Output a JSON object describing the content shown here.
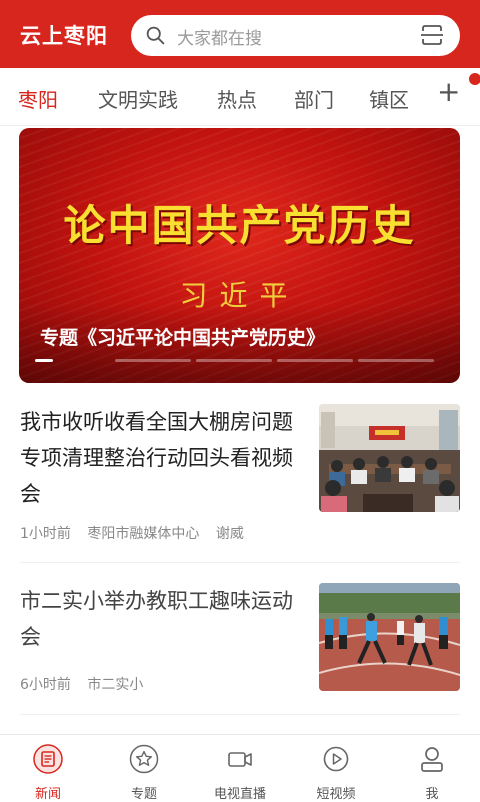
{
  "header": {
    "app_title": "云上枣阳",
    "search_placeholder": "大家都在搜",
    "icons": {
      "search": "search-icon",
      "scan": "scan-icon"
    }
  },
  "tabs": {
    "items": [
      {
        "label": "枣阳",
        "active": true
      },
      {
        "label": "文明实践",
        "active": false
      },
      {
        "label": "热点",
        "active": false
      },
      {
        "label": "部门",
        "active": false
      },
      {
        "label": "镇区",
        "active": false
      }
    ],
    "add_label": "+"
  },
  "banner": {
    "headline": "论中国共产党历史",
    "author": "习近平",
    "caption": "专题《习近平论中国共产党历史》",
    "slide_count": 5,
    "active_slide": 1
  },
  "news": [
    {
      "title": "我市收听收看全国大棚房问题专项清理整治行动回头看视频会",
      "time": "1小时前",
      "source": "枣阳市融媒体中心",
      "author": "谢威"
    },
    {
      "title": "市二实小举办教职工趣味运动会",
      "time": "6小时前",
      "source": "市二实小",
      "author": ""
    }
  ],
  "bottom_nav": [
    {
      "label": "新闻",
      "icon": "news-icon",
      "active": true
    },
    {
      "label": "专题",
      "icon": "star-icon",
      "active": false
    },
    {
      "label": "电视直播",
      "icon": "video-camera-icon",
      "active": false
    },
    {
      "label": "短视频",
      "icon": "play-icon",
      "active": false
    },
    {
      "label": "我",
      "icon": "user-icon",
      "active": false
    }
  ],
  "colors": {
    "brand": "#d7261e",
    "banner_text": "#f8df30"
  }
}
